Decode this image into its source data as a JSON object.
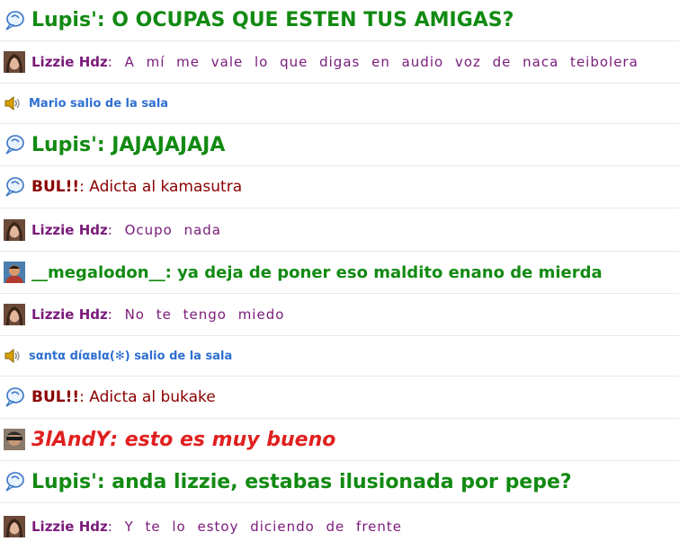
{
  "messages": [
    {
      "nick": "Lupis'",
      "sep": ": ",
      "text": "O OCUPAS QUE ESTEN TUS AMIGAS?",
      "icon": "bubble-icon"
    },
    {
      "nick": "Lizzie Hdz",
      "sep": ": ",
      "text": "A mí me vale lo que digas en audio voz de naca teibolera",
      "icon": "avatar-lizzie-icon"
    },
    {
      "nick": "",
      "sep": "",
      "text": "Mario salio de la sala",
      "icon": "speaker-icon"
    },
    {
      "nick": "Lupis'",
      "sep": ": ",
      "text": "JAJAJAJAJA",
      "icon": "bubble-icon"
    },
    {
      "nick": "BUL!!",
      "sep": ": ",
      "text": "Adicta al kamasutra",
      "icon": "bubble-icon"
    },
    {
      "nick": "Lizzie Hdz",
      "sep": ": ",
      "text": "Ocupo nada",
      "icon": "avatar-lizzie-icon"
    },
    {
      "nick": "__megalodon__",
      "sep": ": ",
      "text": "ya deja de poner eso maldito enano de mierda",
      "icon": "avatar-megalodon-icon"
    },
    {
      "nick": "Lizzie Hdz",
      "sep": ": ",
      "text": "No te tengo miedo",
      "icon": "avatar-lizzie-icon"
    },
    {
      "nick": "",
      "sep": "",
      "text": "sαntα díαвlα(✻) salio de la sala",
      "icon": "speaker-icon"
    },
    {
      "nick": "BUL!!",
      "sep": ": ",
      "text": "Adicta al bukake",
      "icon": "bubble-icon"
    },
    {
      "nick": "3lAndY",
      "sep": ": ",
      "text": "esto es muy bueno",
      "icon": "avatar-3landy-icon"
    },
    {
      "nick": "Lupis'",
      "sep": ": ",
      "text": "anda lizzie, estabas ilusionada por pepe?",
      "icon": "bubble-icon"
    },
    {
      "nick": "Lizzie Hdz",
      "sep": ": ",
      "text": "Y te lo estoy diciendo de frente",
      "icon": "avatar-lizzie-icon"
    }
  ],
  "colors": {
    "lupis": "#128a12",
    "lizzie": "#7a1a7a",
    "bul": "#8b0000",
    "system": "#2e6fd0",
    "landy": "#e02020",
    "divider": "#e8e8e8"
  }
}
